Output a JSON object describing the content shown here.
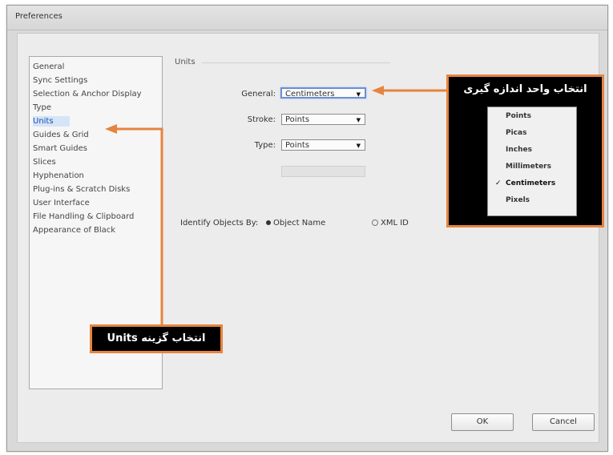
{
  "window": {
    "title": "Preferences"
  },
  "sidebar": {
    "items": [
      {
        "label": "General"
      },
      {
        "label": "Sync Settings"
      },
      {
        "label": "Selection & Anchor Display"
      },
      {
        "label": "Type"
      },
      {
        "label": "Units"
      },
      {
        "label": "Guides & Grid"
      },
      {
        "label": "Smart Guides"
      },
      {
        "label": "Slices"
      },
      {
        "label": "Hyphenation"
      },
      {
        "label": "Plug-ins & Scratch Disks"
      },
      {
        "label": "User Interface"
      },
      {
        "label": "File Handling & Clipboard"
      },
      {
        "label": "Appearance of Black"
      }
    ],
    "selected": "Units"
  },
  "units": {
    "heading": "Units",
    "general": {
      "label": "General:",
      "value": "Centimeters"
    },
    "stroke": {
      "label": "Stroke:",
      "value": "Points"
    },
    "type": {
      "label": "Type:",
      "value": "Points"
    },
    "identify": {
      "label": "Identify Objects By:",
      "option1": "Object Name",
      "option2": "XML ID"
    }
  },
  "buttons": {
    "ok": "OK",
    "cancel": "Cancel"
  },
  "callouts": {
    "select_units": "انتخاب گزینه Units",
    "select_measure": "انتخاب واحد اندازه گیری"
  },
  "dropdown_popup": {
    "options": [
      "Points",
      "Picas",
      "Inches",
      "Millimeters",
      "Centimeters",
      "Pixels"
    ],
    "checked": "Centimeters"
  },
  "colors": {
    "callout_border": "#e6843e",
    "callout_bg": "#000000",
    "selection_text": "#1a4fb0"
  }
}
